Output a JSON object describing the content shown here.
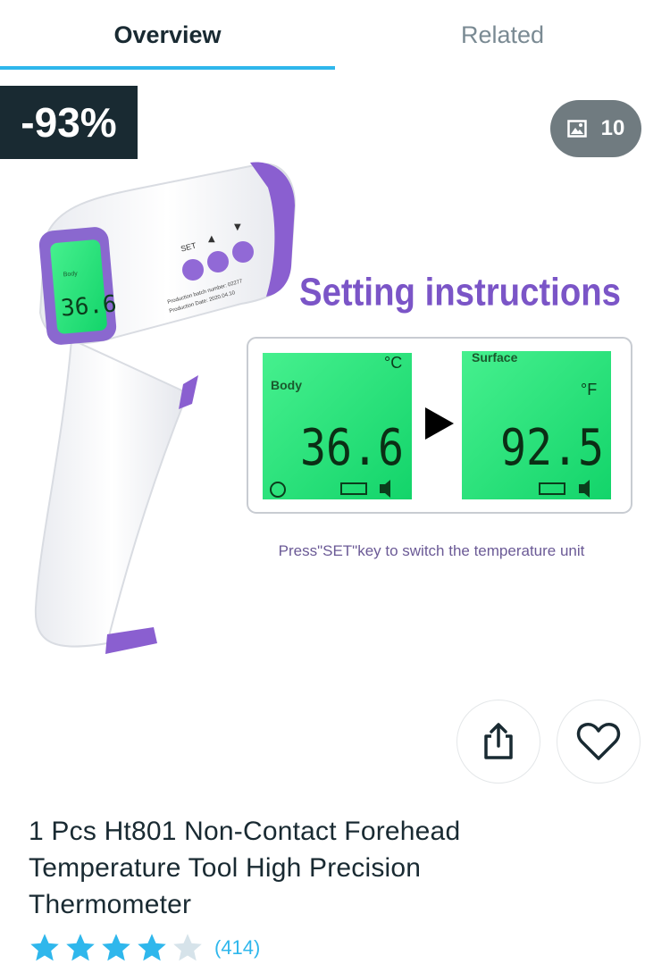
{
  "tabs": [
    {
      "label": "Overview",
      "active": true
    },
    {
      "label": "Related",
      "active": false
    }
  ],
  "badge": {
    "discount": "-93%"
  },
  "gallery": {
    "count": "10",
    "icon": "image-icon"
  },
  "product_image": {
    "heading": "Setting instructions",
    "display_left": {
      "mode": "Body",
      "unit": "°C",
      "value": "36.6"
    },
    "display_right": {
      "mode": "Surface",
      "unit": "°F",
      "value": "92.5"
    },
    "device_display": "36.6",
    "device_labels": {
      "set": "SET",
      "line1": "Production  batch number: 02277",
      "line2": "Production  Date: 2020.04.10",
      "body": "Body"
    },
    "caption": "Press\"SET\"key to switch the temperature unit"
  },
  "actions": {
    "share_icon": "share-icon",
    "favorite_icon": "heart-icon"
  },
  "product": {
    "title": "1 Pcs Ht801 Non-Contact Forehead Temperature Tool High Precision Thermometer",
    "rating_value": 4,
    "rating_max": 5,
    "rating_count": "(414)"
  },
  "colors": {
    "accent": "#2fb7ec",
    "dark": "#192a32",
    "purple": "#7b55c7",
    "lcd": "#22e07a"
  }
}
